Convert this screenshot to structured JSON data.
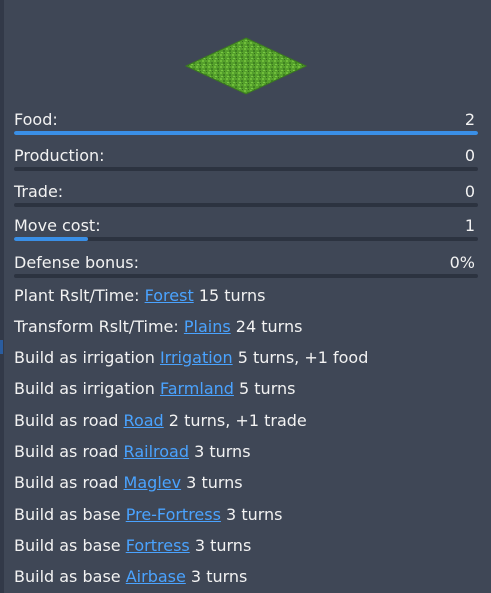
{
  "stats": [
    {
      "label": "Food:",
      "value": "2",
      "fill": 1.0
    },
    {
      "label": "Production:",
      "value": "0",
      "fill": 0
    },
    {
      "label": "Trade:",
      "value": "0",
      "fill": 0
    },
    {
      "label": "Move cost:",
      "value": "1",
      "fill": 0.16
    },
    {
      "label": "Defense bonus:",
      "value": "0%",
      "fill": 0
    }
  ],
  "lines": [
    {
      "prefix": "Plant Rslt/Time:",
      "link": "Forest",
      "suffix": "15 turns"
    },
    {
      "prefix": "Transform Rslt/Time:",
      "link": "Plains",
      "suffix": "24 turns"
    },
    {
      "prefix": "Build as irrigation",
      "link": "Irrigation",
      "suffix": "5 turns, +1 food"
    },
    {
      "prefix": "Build as irrigation",
      "link": "Farmland",
      "suffix": "5 turns"
    },
    {
      "prefix": "Build as road",
      "link": "Road",
      "suffix": "2 turns, +1 trade"
    },
    {
      "prefix": "Build as road",
      "link": "Railroad",
      "suffix": "3 turns"
    },
    {
      "prefix": "Build as road",
      "link": "Maglev",
      "suffix": "3 turns"
    },
    {
      "prefix": "Build as base",
      "link": "Pre-Fortress",
      "suffix": "3 turns"
    },
    {
      "prefix": "Build as base",
      "link": "Fortress",
      "suffix": "3 turns"
    },
    {
      "prefix": "Build as base",
      "link": "Airbase",
      "suffix": "3 turns"
    }
  ],
  "colors": {
    "background": "#3f4756",
    "accent": "#3a8fe6",
    "link": "#4aa3ff",
    "track": "#2c3340",
    "grass": "#4f9a2a"
  },
  "icons": {
    "tile": "grassland-tile-icon"
  }
}
